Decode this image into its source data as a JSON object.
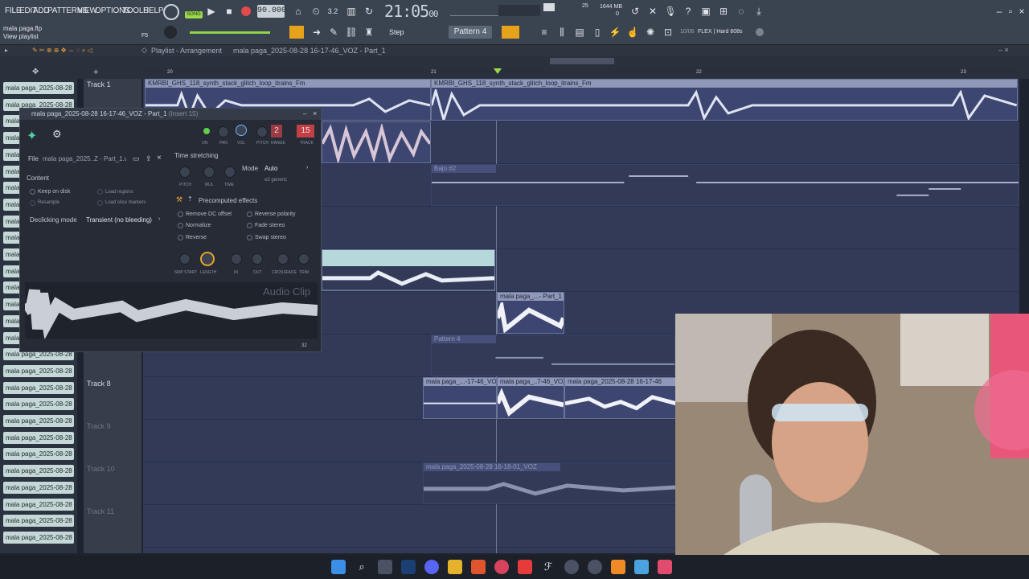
{
  "menu": [
    "FILE",
    "EDIT",
    "ADD",
    "PATTERNS",
    "VIEW",
    "OPTIONS",
    "TOOLS",
    "HELP"
  ],
  "transport": {
    "mode": "SONG",
    "tempo": "90.000",
    "time": "21:05",
    "time_sub": "00",
    "memory": "1644 MB",
    "cpu": "25",
    "voices": "0"
  },
  "project": {
    "file": "mala paga.flp",
    "hint": "View playlist",
    "hint_key": "F5"
  },
  "toolbar2": {
    "snap": "Step",
    "pattern": "Pattern 4",
    "preset": "10/06",
    "plugin": "FLEX | Hard 808s"
  },
  "playlist": {
    "title": "Playlist - Arrangement",
    "breadcrumb": "mala paga_2025-08-28 16-17-46_VOZ - Part_1",
    "ruler": [
      "20",
      "21",
      "22",
      "23"
    ]
  },
  "browser_items": [
    "mala paga_2025-08-28",
    "mala paga_2025-08-28",
    "mala paga_2025-08-28",
    "mala paga_2025-08-28",
    "mala paga_2025-08-28",
    "mala paga_2025-08-28",
    "mala paga_2025-08-28",
    "mala paga_2025-08-28",
    "mala paga_2025-08-28",
    "mala paga_2025-08-28",
    "mala paga_2025-08-28",
    "mala paga_2025-08-28",
    "mala paga_2025-08-28",
    "mala paga_2025-08-28",
    "mala paga_2025-08-28",
    "mala paga_2025-08-28",
    "mala paga_2025-08-28",
    "mala paga_2025-08-28",
    "mala paga_2025-08-28",
    "mala paga_2025-08-28",
    "mala paga_2025-08-28",
    "mala paga_2025-08-28",
    "mala paga_2025-08-28",
    "mala paga_2025-08-28",
    "mala paga_2025-08-28",
    "mala paga_2025-08-28",
    "mala paga_2025-08-28",
    "mala paga_2025-08-28"
  ],
  "tracks": [
    "Track 1",
    "Track 8",
    "Track 9",
    "Track 10",
    "Track 11"
  ],
  "clips": {
    "synth_a": "KMRBI_GHS_118_synth_stack_glitch_loop_itrains_Fm",
    "synth_b": "KMRBI_GHS_118_synth_stack_glitch_loop_itrains_Fm",
    "bajo": "Bajo #2",
    "part1": "mala paga_...- Part_1",
    "pattern4": "Pattern 4",
    "voz_a": "mala paga_...-17-46_VOZ",
    "voz_b": "mala paga_..7-46_VOZ",
    "voz_c": "mala paga_2025-08-28 16-17-46",
    "voz_d": "mala paga_2025-08-28 16-18-01_VOZ"
  },
  "channel_settings": {
    "title": "mala paga_2025-08-28 16-17-46_VOZ - Part_1",
    "insert": "(Insert 15)",
    "knob_labels": [
      "ON",
      "PAN",
      "VOL",
      "PITCH",
      "RANGE",
      "TRACK"
    ],
    "range_value": "2",
    "track_value": "15",
    "file_label": "File",
    "file_name": "mala paga_2025..Z - Part_1.wav",
    "content_label": "Content",
    "keep_on_disk": "Keep on disk",
    "load_regions": "Load regions",
    "resample": "Resample",
    "load_slice_markers": "Load slice markers",
    "declicking_label": "Declicking mode",
    "declicking_value": "Transient (no bleeding)",
    "time_stretching": "Time stretching",
    "ts_knobs": [
      "PITCH",
      "MUL",
      "TIME"
    ],
    "mode_label": "Mode",
    "mode_value": "Auto",
    "mode_sub": "e3 generic",
    "precomputed": "Precomputed effects",
    "effects_left": [
      "Remove DC offset",
      "Normalize",
      "Reverse"
    ],
    "effects_right": [
      "Reverse polarity",
      "Fade stereo",
      "Swap stereo"
    ],
    "env_knobs": [
      "SMP START",
      "LENGTH",
      "IN",
      "OUT",
      "CROSSFADE",
      "TRIM"
    ],
    "watermark": "Audio Clip",
    "zoom": "32"
  }
}
